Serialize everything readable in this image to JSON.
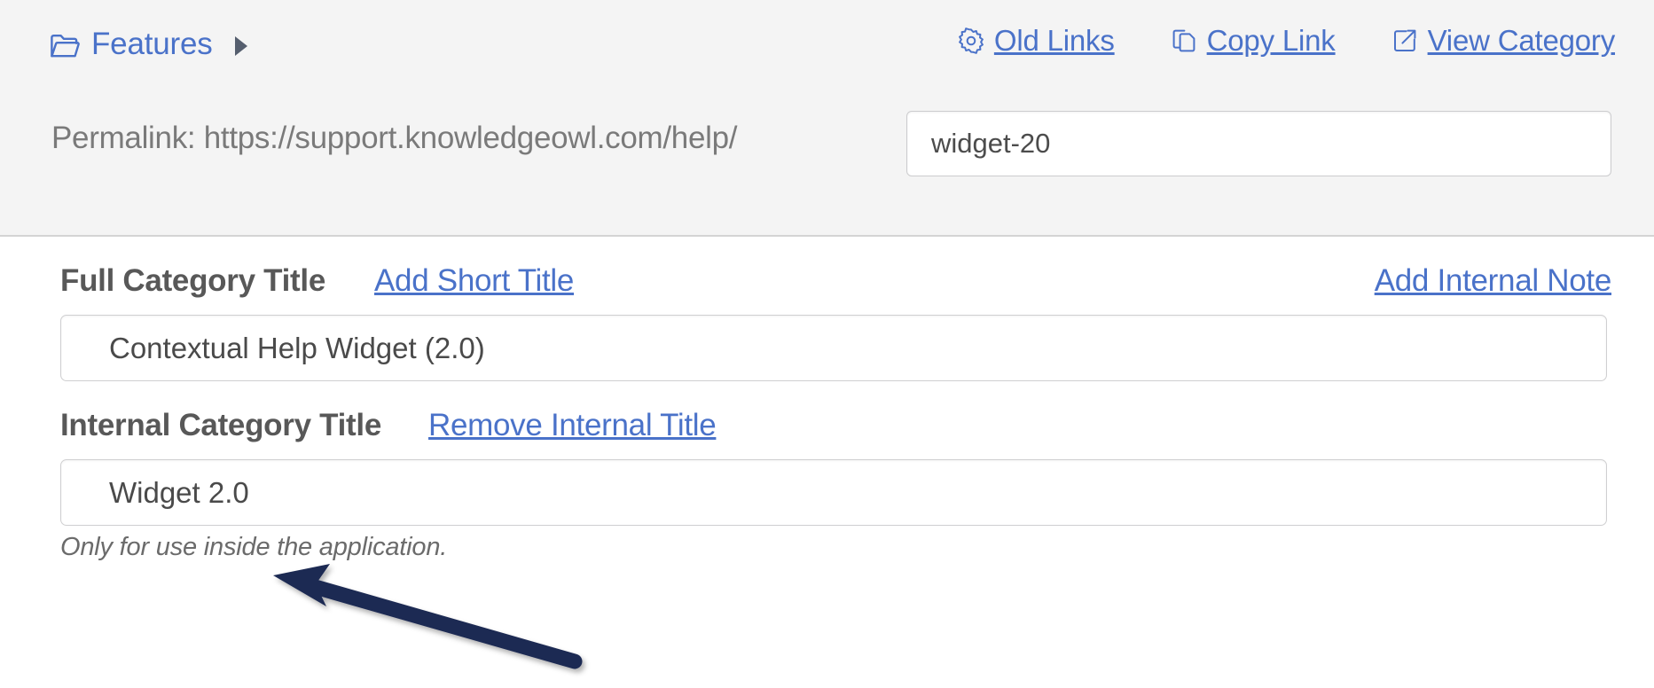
{
  "header": {
    "breadcrumb": {
      "folder_icon": "open-folder-icon",
      "label": "Features",
      "caret_icon": "caret-right-icon"
    },
    "actions": [
      {
        "label": "Old Links",
        "icon": "gear-icon"
      },
      {
        "label": "Copy Link",
        "icon": "copy-icon"
      },
      {
        "label": "View Category",
        "icon": "external-link-icon"
      }
    ],
    "permalink": {
      "label": "Permalink: https://support.knowledgeowl.com/help/",
      "value": "widget-20",
      "placeholder": "url-slug"
    }
  },
  "form": {
    "full_title": {
      "label": "Full Category Title",
      "add_short_title_link": "Add Short Title",
      "add_internal_note_link": "Add Internal Note",
      "value": "Contextual Help Widget (2.0)",
      "placeholder": "Enter category title"
    },
    "internal_title": {
      "label": "Internal Category Title",
      "remove_link": "Remove Internal Title",
      "value": "Widget 2.0",
      "placeholder": "Enter internal title",
      "helper_text": "Only for use inside the application."
    }
  },
  "annotation": {
    "arrow_name": "annotation-arrow-to-internal-title",
    "arrow_color": "#1e2a52"
  },
  "colors": {
    "link_blue": "#4a72c9",
    "label_gray": "#585858",
    "muted_gray": "#7a7a7a",
    "header_bg": "#f4f4f4",
    "page_bg": "#ffffff",
    "input_border": "#cfcfd1"
  }
}
